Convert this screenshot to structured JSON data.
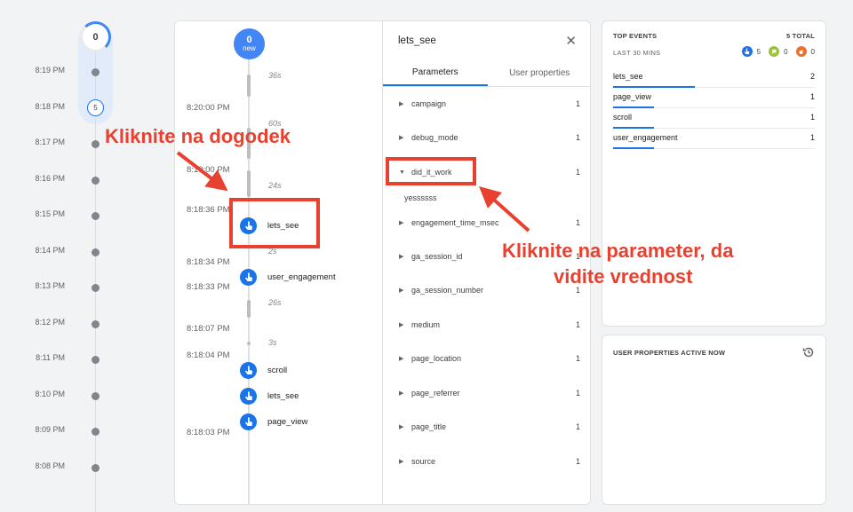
{
  "minute_timeline": {
    "top_count": "0",
    "rows": [
      {
        "time": "8:19 PM"
      },
      {
        "time": "8:18 PM",
        "count": "5"
      },
      {
        "time": "8:17 PM"
      },
      {
        "time": "8:16 PM"
      },
      {
        "time": "8:15 PM"
      },
      {
        "time": "8:14 PM"
      },
      {
        "time": "8:13 PM"
      },
      {
        "time": "8:12 PM"
      },
      {
        "time": "8:11 PM"
      },
      {
        "time": "8:10 PM"
      },
      {
        "time": "8:09 PM"
      },
      {
        "time": "8:08 PM"
      }
    ]
  },
  "seconds_timeline": {
    "new_count": "0",
    "new_label": "new",
    "durations": [
      "36s",
      "60s",
      "24s",
      "2s",
      "26s",
      "3s"
    ],
    "timestamps": [
      "8:20:00 PM",
      "8:19:00 PM",
      "8:18:36 PM",
      "8:18:34 PM",
      "8:18:33 PM",
      "8:18:07 PM",
      "8:18:04 PM",
      "8:18:03 PM"
    ],
    "events": [
      "lets_see",
      "user_engagement",
      "scroll",
      "lets_see",
      "page_view"
    ]
  },
  "event_panel": {
    "title": "lets_see",
    "close_icon": "close-icon",
    "tabs": [
      "Parameters",
      "User properties"
    ],
    "parameters": [
      {
        "name": "campaign",
        "count": "1"
      },
      {
        "name": "debug_mode",
        "count": "1"
      },
      {
        "name": "did_it_work",
        "count": "1",
        "expanded": true,
        "value": "yessssss"
      },
      {
        "name": "engagement_time_msec",
        "count": "1"
      },
      {
        "name": "ga_session_id",
        "count": "1"
      },
      {
        "name": "ga_session_number",
        "count": "1"
      },
      {
        "name": "medium",
        "count": "1"
      },
      {
        "name": "page_location",
        "count": "1"
      },
      {
        "name": "page_referrer",
        "count": "1"
      },
      {
        "name": "page_title",
        "count": "1"
      },
      {
        "name": "source",
        "count": "1"
      }
    ]
  },
  "top_events": {
    "title": "TOP EVENTS",
    "total": "5 TOTAL",
    "subtitle": "LAST 30 MINS",
    "badges": [
      {
        "icon": "hand-pointer-icon",
        "count": "5",
        "color": "#1a73e8"
      },
      {
        "icon": "flag-icon",
        "count": "0",
        "color": "#9cc23a"
      },
      {
        "icon": "bomb-icon",
        "count": "0",
        "color": "#e8712f"
      }
    ],
    "rows": [
      {
        "name": "lets_see",
        "count": "2",
        "share": 0.4
      },
      {
        "name": "page_view",
        "count": "1",
        "share": 0.2
      },
      {
        "name": "scroll",
        "count": "1",
        "share": 0.2
      },
      {
        "name": "user_engagement",
        "count": "1",
        "share": 0.2
      }
    ]
  },
  "user_properties": {
    "title": "USER PROPERTIES ACTIVE NOW",
    "icon": "history-icon"
  },
  "annotations": {
    "click_event": "Kliknite na dogodek",
    "click_param_1": "Kliknite na parameter, da",
    "click_param_2": "vidite vrednost",
    "color": "#e8412f"
  }
}
